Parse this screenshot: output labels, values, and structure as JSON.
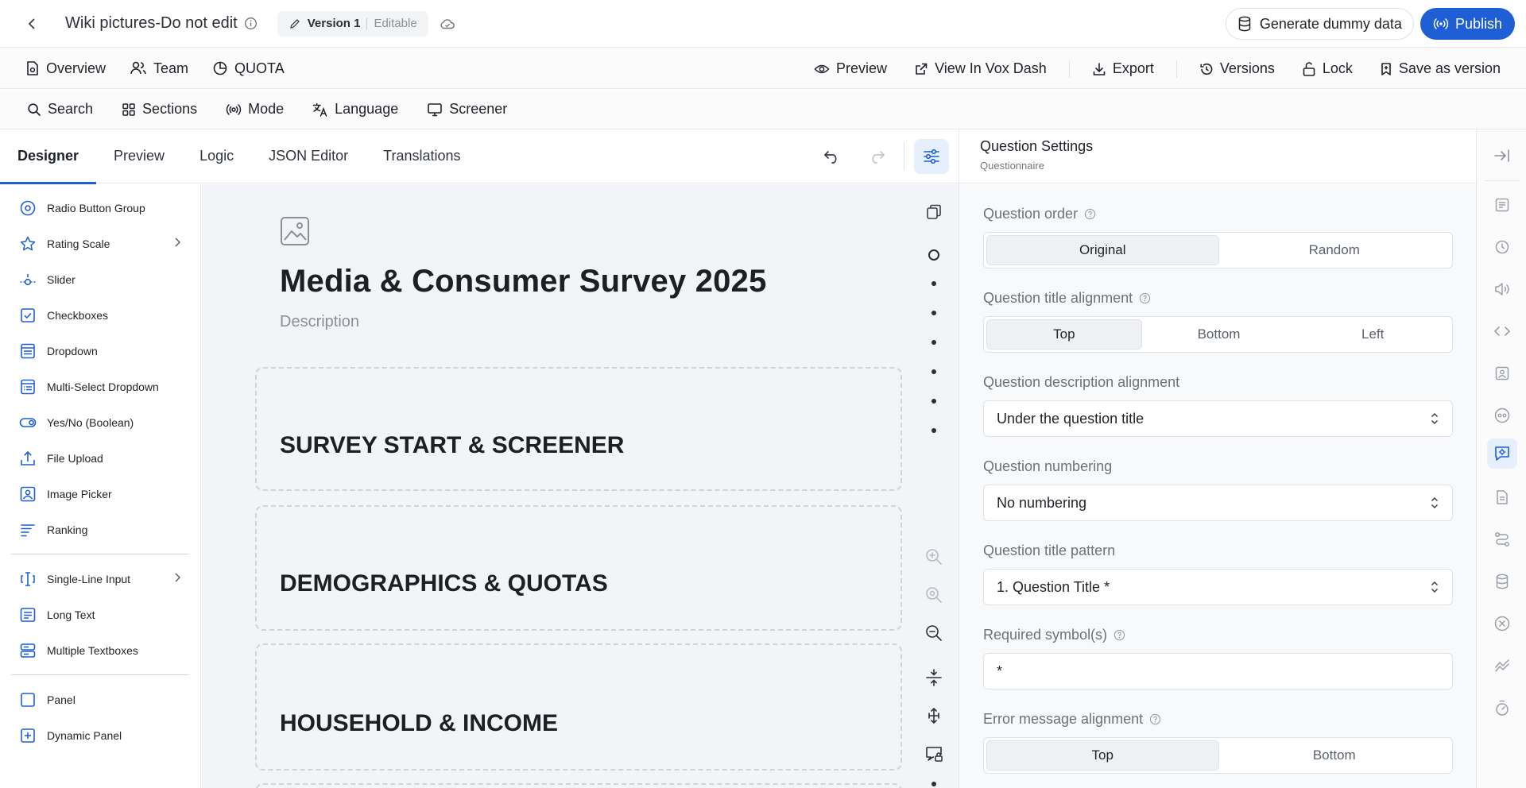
{
  "header": {
    "title": "Wiki pictures-Do not edit",
    "version": "Version 1",
    "version_state": "Editable",
    "generate_label": "Generate dummy data",
    "publish_label": "Publish"
  },
  "nav": {
    "left": [
      "Overview",
      "Team",
      "QUOTA"
    ],
    "right": [
      "Preview",
      "View In Vox Dash",
      "Export",
      "Versions",
      "Lock",
      "Save as version"
    ]
  },
  "toolbar": [
    "Search",
    "Sections",
    "Mode",
    "Language",
    "Screener"
  ],
  "editor_tabs": [
    "Designer",
    "Preview",
    "Logic",
    "JSON Editor",
    "Translations"
  ],
  "toolbox": {
    "group1": [
      "Radio Button Group",
      "Rating Scale",
      "Slider",
      "Checkboxes",
      "Dropdown",
      "Multi-Select Dropdown",
      "Yes/No (Boolean)",
      "File Upload",
      "Image Picker",
      "Ranking"
    ],
    "group2": [
      "Single-Line Input",
      "Long Text",
      "Multiple Textboxes"
    ],
    "group3": [
      "Panel",
      "Dynamic Panel"
    ]
  },
  "survey": {
    "title": "Media & Consumer Survey 2025",
    "description": "Description",
    "pages": [
      "SURVEY START & SCREENER",
      "DEMOGRAPHICS & QUOTAS",
      "HOUSEHOLD & INCOME"
    ]
  },
  "settings": {
    "title": "Question Settings",
    "subtitle": "Questionnaire",
    "question_order": {
      "label": "Question order",
      "options": [
        "Original",
        "Random"
      ],
      "selected": "Original"
    },
    "title_alignment": {
      "label": "Question title alignment",
      "options": [
        "Top",
        "Bottom",
        "Left"
      ],
      "selected": "Top"
    },
    "description_alignment": {
      "label": "Question description alignment",
      "value": "Under the question title"
    },
    "numbering": {
      "label": "Question numbering",
      "value": "No numbering"
    },
    "title_pattern": {
      "label": "Question title pattern",
      "value": "1. Question Title *"
    },
    "required_symbol": {
      "label": "Required symbol(s)",
      "value": "*"
    },
    "error_alignment": {
      "label": "Error message alignment",
      "options": [
        "Top",
        "Bottom"
      ],
      "selected": "Top"
    }
  },
  "colors": {
    "accent": "#1f5fd6",
    "canvas": "#f2f4f7"
  }
}
